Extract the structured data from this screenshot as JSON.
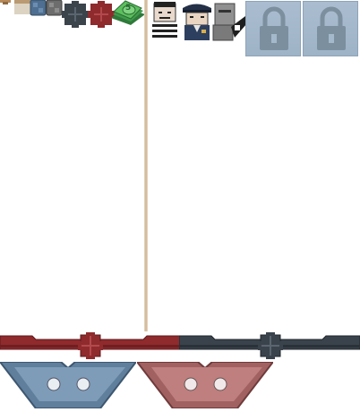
{
  "toolbar": {
    "items": [
      {
        "name": "sword-icon"
      },
      {
        "name": "scroll-icon"
      },
      {
        "name": "blue-tile-icon"
      },
      {
        "name": "gray-tile-icon"
      },
      {
        "name": "dark-cross-block-icon"
      },
      {
        "name": "red-cross-block-icon"
      },
      {
        "name": "money-stack-icon"
      },
      {
        "name": "prisoner-icon"
      },
      {
        "name": "police-officer-icon"
      },
      {
        "name": "robot-icon"
      }
    ],
    "cash_denomination": "5",
    "locked_slots": 2
  },
  "colors": {
    "red_bar": "#8f2a2d",
    "dark_bar": "#3a434c",
    "blue_tray": "#5f7f9c",
    "red_tray": "#a26161",
    "lock_bg": "#a5b9cc",
    "lock_icon": "#7c8f9f"
  }
}
